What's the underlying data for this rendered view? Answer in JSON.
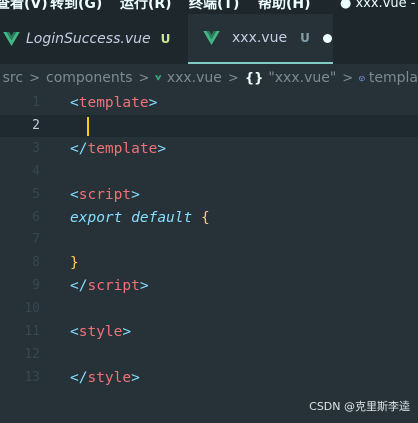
{
  "menubar": {
    "items": [
      "查看(V)",
      "转到(G)",
      "运行(R)",
      "终端(T)",
      "帮助(H)"
    ],
    "window_title": "● xxx.vue -"
  },
  "tabs": [
    {
      "label": "LoginSuccess.vue",
      "badge": "U",
      "icon": "vue-logo-icon",
      "italic": true
    },
    {
      "label": "xxx.vue",
      "badge": "U",
      "icon": "vue-logo-icon",
      "active": true,
      "unsaved": true
    }
  ],
  "breadcrumb": {
    "segments": [
      "src",
      "components",
      "xxx.vue",
      "\"xxx.vue\"",
      "templa"
    ],
    "braces_icon": "{}"
  },
  "editor": {
    "current_line": 2,
    "lines": [
      {
        "num": "1",
        "tokens": [
          [
            "punct",
            "<"
          ],
          [
            "tag",
            "template"
          ],
          [
            "punct",
            ">"
          ]
        ]
      },
      {
        "num": "2",
        "tokens": []
      },
      {
        "num": "3",
        "tokens": [
          [
            "punct",
            "</"
          ],
          [
            "tag",
            "template"
          ],
          [
            "punct",
            ">"
          ]
        ]
      },
      {
        "num": "4",
        "tokens": []
      },
      {
        "num": "5",
        "tokens": [
          [
            "punct",
            "<"
          ],
          [
            "tag",
            "script"
          ],
          [
            "punct",
            ">"
          ]
        ]
      },
      {
        "num": "6",
        "tokens": [
          [
            "kw",
            "export"
          ],
          [
            "plain",
            " "
          ],
          [
            "kw",
            "default"
          ],
          [
            "plain",
            " "
          ],
          [
            "brace",
            "{"
          ]
        ]
      },
      {
        "num": "7",
        "tokens": []
      },
      {
        "num": "8",
        "tokens": [
          [
            "brace",
            "}"
          ]
        ]
      },
      {
        "num": "9",
        "tokens": [
          [
            "punct",
            "</"
          ],
          [
            "tag",
            "script"
          ],
          [
            "punct",
            ">"
          ]
        ]
      },
      {
        "num": "10",
        "tokens": []
      },
      {
        "num": "11",
        "tokens": [
          [
            "punct",
            "<"
          ],
          [
            "tag",
            "style"
          ],
          [
            "punct",
            ">"
          ]
        ]
      },
      {
        "num": "12",
        "tokens": []
      },
      {
        "num": "13",
        "tokens": [
          [
            "punct",
            "</"
          ],
          [
            "tag",
            "style"
          ],
          [
            "punct",
            ">"
          ]
        ]
      }
    ]
  },
  "watermark": "CSDN @克里斯李逵",
  "colors": {
    "background": "#263238",
    "tag": "#f07178",
    "punctuation": "#89ddff",
    "keyword": "#89ddff",
    "brace": "#ffcb6b",
    "cursor": "#ffcc00",
    "untracked_badge": "#c3e88d"
  }
}
